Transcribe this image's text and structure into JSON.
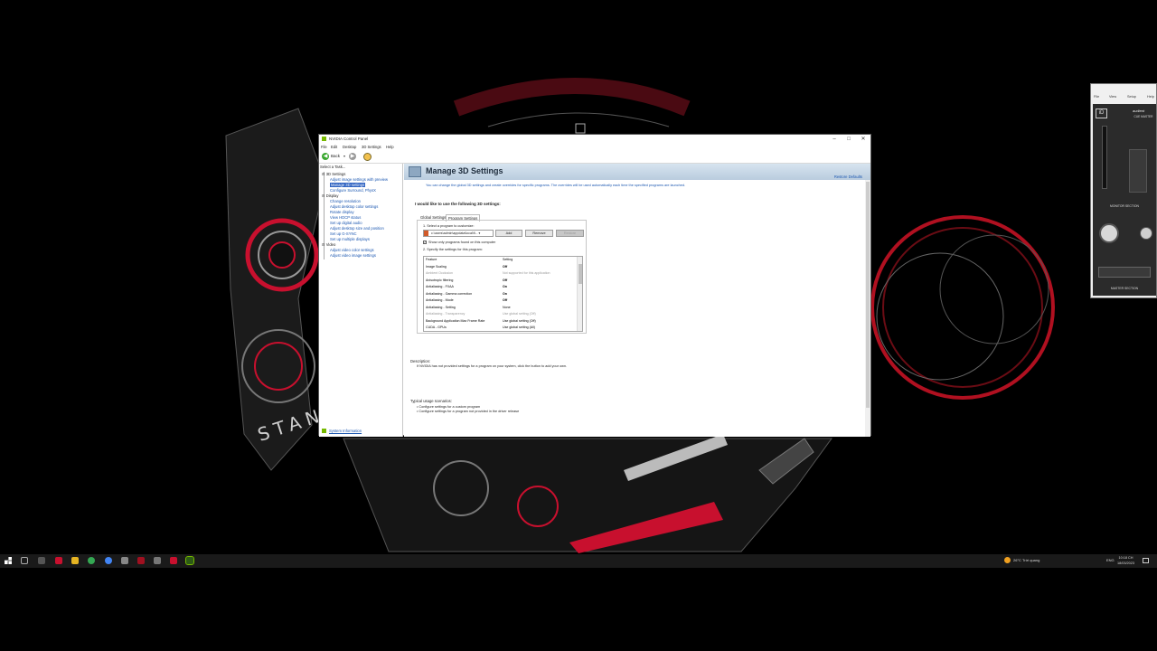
{
  "window": {
    "title": "NVIDIA Control Panel",
    "menu": [
      "File",
      "Edit",
      "Desktop",
      "3D Settings",
      "Help"
    ],
    "toolbar": {
      "back_label": "Back"
    },
    "controls": {
      "minimize": "–",
      "maximize": "□",
      "close": "✕"
    }
  },
  "task_pane": {
    "header": "Select a Task...",
    "categories": [
      {
        "label": "3D Settings",
        "items": [
          "Adjust image settings with preview",
          "Manage 3D settings",
          "Configure Surround, PhysX"
        ]
      },
      {
        "label": "Display",
        "items": [
          "Change resolution",
          "Adjust desktop color settings",
          "Rotate display",
          "View HDCP status",
          "Set up digital audio",
          "Adjust desktop size and position",
          "Set up G-SYNC",
          "Set up multiple displays"
        ]
      },
      {
        "label": "Video",
        "items": [
          "Adjust video color settings",
          "Adjust video image settings"
        ]
      }
    ],
    "selected_item": "Manage 3D settings",
    "system_info": "System Information"
  },
  "content": {
    "title": "Manage 3D Settings",
    "restore_defaults": "Restore Defaults",
    "intro": "You can change the global 3D settings and create overrides for specific programs. The overrides will be used automatically each time the specified programs are launched.",
    "section_label": "I would like to use the following 3D settings:",
    "tabs": [
      "Global Settings",
      "Program Settings"
    ],
    "active_tab": "Program Settings",
    "step1": "1. Select a program to customize:",
    "program_value": "c:\\users\\admin\\appdata\\local\\fi...",
    "buttons": {
      "add": "Add",
      "remove": "Remove",
      "restore": "Restore"
    },
    "show_only_label": "Show only programs found on this computer",
    "show_only_checked": true,
    "step2": "2. Specify the settings for this program:",
    "grid_headers": {
      "feature": "Feature",
      "setting": "Setting"
    },
    "grid_rows": [
      {
        "feature": "Image Scaling",
        "setting": "Off",
        "disabled": false
      },
      {
        "feature": "Ambient Occlusion",
        "setting": "Not supported for this application",
        "disabled": true
      },
      {
        "feature": "Anisotropic filtering",
        "setting": "Off",
        "disabled": false
      },
      {
        "feature": "Antialiasing - FXAA",
        "setting": "On",
        "disabled": false
      },
      {
        "feature": "Antialiasing - Gamma correction",
        "setting": "On",
        "disabled": false
      },
      {
        "feature": "Antialiasing - Mode",
        "setting": "Off",
        "disabled": false
      },
      {
        "feature": "Antialiasing - Setting",
        "setting": "None",
        "disabled": false
      },
      {
        "feature": "Antialiasing - Transparency",
        "setting": "Use global setting (Off)",
        "disabled": true
      },
      {
        "feature": "Background Application Max Frame Rate",
        "setting": "Use global setting (Off)",
        "disabled": false
      },
      {
        "feature": "CUDA - GPUs",
        "setting": "Use global setting (All)",
        "disabled": false
      }
    ],
    "description_label": "Description:",
    "description_text": "If NVIDIA has not provided settings for a program on your system, click the button to add your own.",
    "usage_label": "Typical usage scenarios:",
    "usage_items": [
      "Configure settings for a custom program",
      "Configure settings for a program not provided in the driver release"
    ]
  },
  "audient": {
    "menu": [
      "File",
      "View",
      "Setup",
      "Help"
    ],
    "brand": "audient",
    "cue_label": "CUE MASTER",
    "monitor_label": "MONITOR SECTION",
    "master_label": "MASTER SECTION"
  },
  "wallpaper": {
    "text": "STANDA"
  },
  "taskbar": {
    "weather": "26°C  Trời quang",
    "language": "ENG",
    "time": "10:18 CH",
    "date": "18/03/2023"
  },
  "colors": {
    "nvidia_green": "#76b900",
    "selection_blue": "#2f63c2",
    "link_blue": "#1a56b0",
    "wallpaper_red": "#c8102e"
  }
}
